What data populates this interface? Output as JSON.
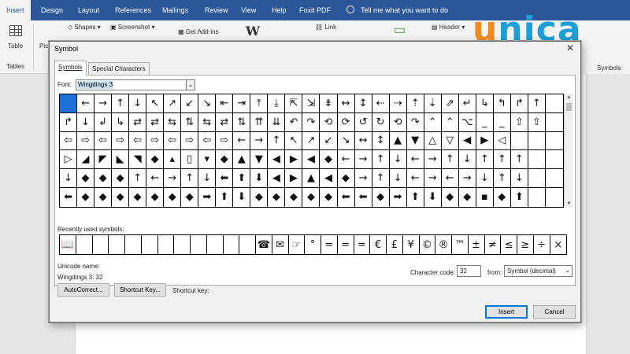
{
  "ribbon": {
    "tabs": [
      "Insert",
      "Design",
      "Layout",
      "References",
      "Mailings",
      "Review",
      "View",
      "Help",
      "Foxit PDF"
    ],
    "tell_me": "Tell me what you want to do",
    "items": {
      "table": "Table",
      "tables_group": "Tables",
      "pictures": "Pic",
      "shapes": "Shapes",
      "screenshot": "Screenshot",
      "get_addins": "Get Add-ins",
      "link": "Link",
      "header": "Header",
      "symbols_group": "Symbols"
    }
  },
  "logo": {
    "first": "u",
    "rest": "nica"
  },
  "dialog": {
    "title": "Symbol",
    "tabs": [
      "Symbols",
      "Special Characters"
    ],
    "font_label": "Font:",
    "font_value": "Wingdings 3",
    "symbol_rows": [
      [
        "",
        "←",
        "→",
        "↑",
        "↓",
        "↖",
        "↗",
        "↙",
        "↘",
        "⇤",
        "⇥",
        "⤒",
        "⤓",
        "⇱",
        "⇲",
        "⇟",
        "↔",
        "↕",
        "⇠",
        "⇢",
        "⇡",
        "⇣",
        "⇗",
        "↵",
        "↳",
        "↰",
        "↱",
        "↑"
      ],
      [
        "↱",
        "↓",
        "↲",
        "↳",
        "⇄",
        "⇄",
        "⇆",
        "⇅",
        "⇆",
        "⇄",
        "⇅",
        "⇈",
        "⇊",
        "↶",
        "↷",
        "⟲",
        "⟳",
        "↺",
        "↻",
        "⟲",
        "↷",
        "⌃",
        "⌃",
        "⌥",
        "_",
        "_",
        "⇧",
        "⇧"
      ],
      [
        "⇦",
        "⇨",
        "⇦",
        "⇨",
        "⇦",
        "⇨",
        "⇦",
        "⇨",
        "⇦",
        "⇨",
        "←",
        "→",
        "↑",
        "↖",
        "↗",
        "↙",
        "↘",
        "↔",
        "↕",
        "▲",
        "▼",
        "△",
        "▽",
        "◀",
        "▶",
        "◁"
      ],
      [
        "▷",
        "◢",
        "◤",
        "◣",
        "◥",
        "◆",
        "▴",
        "▯",
        "▾",
        "◆",
        "▲",
        "▼",
        "◀",
        "▶",
        "◀",
        "◆",
        "←",
        "→",
        "↑",
        "↓",
        "←",
        "→",
        "↑",
        "↓",
        "↑",
        "↑",
        "↑"
      ],
      [
        "↓",
        "◆",
        "◆",
        "◆",
        "↑",
        "←",
        "→",
        "↑",
        "↓",
        "⬅",
        "⬆",
        "⬇",
        "◀",
        "▶",
        "▲",
        "◀",
        "◆",
        "→",
        "↑",
        "↓",
        "←",
        "→",
        "←",
        "→",
        "↓",
        "↑",
        "↓"
      ],
      [
        "⬅",
        "◆",
        "◆",
        "◆",
        "◆",
        "◆",
        "◆",
        "◆",
        "➡",
        "⬆",
        "⬇",
        "◆",
        "◆",
        "◆",
        "◆",
        "◆",
        "⬅",
        "⬅",
        "◆",
        "➡",
        "⬆",
        "⬇",
        "◆",
        "◆",
        "▪",
        "◆",
        "⬆"
      ]
    ],
    "recent_label": "Recently used symbols:",
    "recent_symbols": [
      "📖",
      "",
      "",
      "",
      "",
      "",
      "",
      "",
      "",
      "",
      "",
      "",
      "☎",
      "✉",
      "☞",
      "°",
      "=",
      "=",
      "=",
      "€",
      "£",
      "¥",
      "©",
      "®",
      "™",
      "±",
      "≠",
      "≤",
      "≥",
      "÷",
      "×"
    ],
    "unicode_name_label": "Unicode name:",
    "unicode_name_value": "Wingdings 3: 32",
    "char_code_label": "Character code:",
    "char_code_value": "32",
    "from_label": "from:",
    "from_value": "Symbol (decimal)",
    "autocorrect_label": "AutoCorrect...",
    "shortcut_key_button": "Shortcut Key...",
    "shortcut_key_label": "Shortcut key:",
    "insert_label": "Insert",
    "cancel_label": "Cancel"
  },
  "colors": {
    "ribbon_blue": "#2b579a",
    "selection_blue": "#1e6fd8",
    "logo_orange": "#f08a24",
    "logo_blue": "#1e9fd8"
  }
}
